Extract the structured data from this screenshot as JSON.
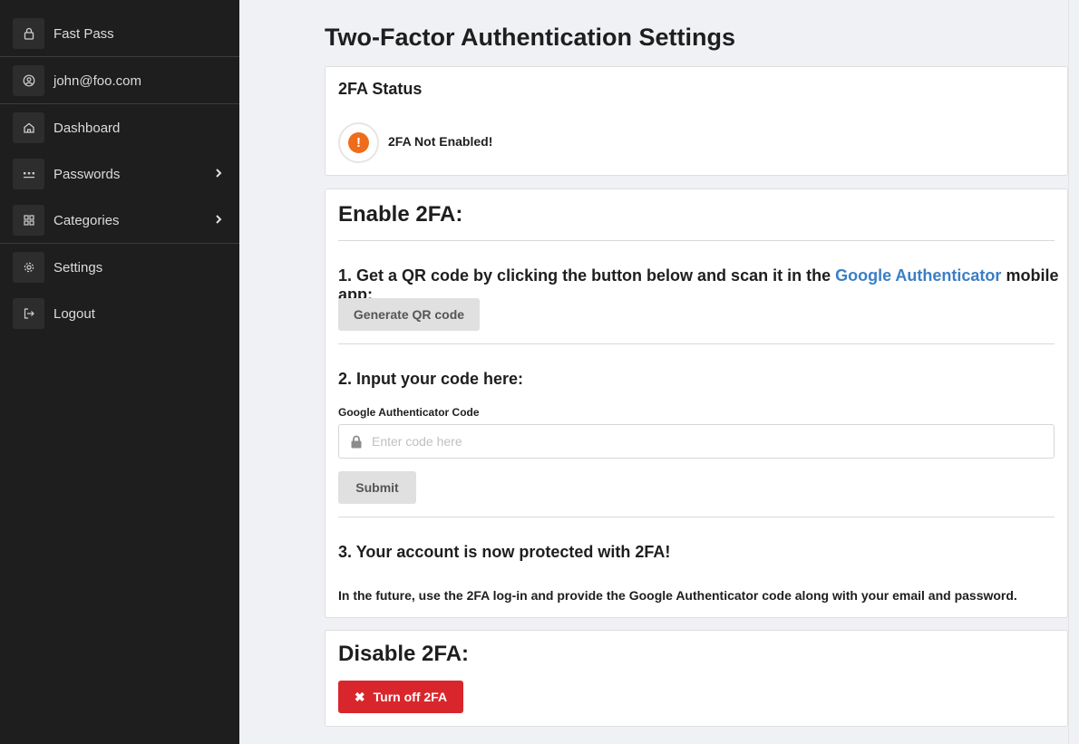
{
  "sidebar": {
    "items": [
      {
        "label": "Fast Pass",
        "icon": "lock-icon"
      },
      {
        "label": "john@foo.com",
        "icon": "user-circle-icon"
      },
      {
        "label": "Dashboard",
        "icon": "home-icon"
      },
      {
        "label": "Passwords",
        "icon": "dots-icon",
        "chevron": "›"
      },
      {
        "label": "Categories",
        "icon": "grid-icon",
        "chevron": "›"
      },
      {
        "label": "Settings",
        "icon": "gear-icon"
      },
      {
        "label": "Logout",
        "icon": "logout-icon"
      }
    ]
  },
  "page": {
    "title": "Two-Factor Authentication Settings"
  },
  "status_card": {
    "title": "2FA Status",
    "icon": "!",
    "status_text": "2FA Not Enabled!",
    "status_color": "#ef6c1a"
  },
  "enable_card": {
    "title": "Enable 2FA:",
    "step1_prefix": "1. Get a QR code by clicking the button below and scan it in the",
    "step1_link": "Google Authenticator",
    "step1_suffix": "mobile app:",
    "generate_button": "Generate QR code",
    "step2_title": "2. Input your code here:",
    "field_label": "Google Authenticator Code",
    "field_placeholder": "Enter code here",
    "field_value": "",
    "submit_button": "Submit",
    "step3_title": "3. Your account is now protected with 2FA!",
    "note": "In the future, use the 2FA log-in and provide the Google Authenticator code along with your email and password."
  },
  "disable_card": {
    "title": "Disable 2FA:",
    "button_icon": "✖",
    "button_label": "Turn off 2FA",
    "button_color": "#d9262c"
  },
  "colors": {
    "sidebar_bg": "#1e1e1e",
    "page_bg": "#f0f1f5",
    "link": "#3b7fc4"
  }
}
